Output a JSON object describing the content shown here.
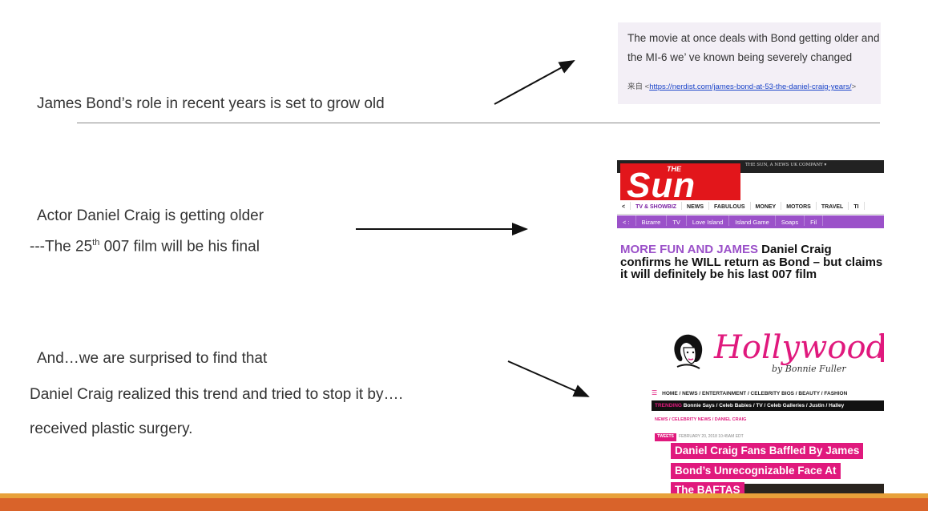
{
  "slide": {
    "line1": "James Bond’s role in recent years is set to grow old",
    "line2": "Actor Daniel Craig is getting older",
    "line3_prefix": "---The 25",
    "line3_sup": "th",
    "line3_suffix": " 007 film will be his final",
    "line4": "And…we are surprised to find that",
    "line5": "Daniel Craig realized this trend and tried to stop it by….",
    "line6": "received plastic surgery."
  },
  "quote": {
    "text": "The movie at once deals with Bond getting older and the MI-6 we’ ve known being severely changed",
    "source_prefix": "来自 <",
    "source_link": "https://nerdist.com/james-bond-at-53-the-daniel-craig-years/",
    "source_suffix": ">"
  },
  "sun": {
    "top_bar": "THE SUN, A NEWS UK COMPANY ▾",
    "logo_small": "THE",
    "logo_big": "Sun",
    "nav": [
      "<",
      "TV & SHOWBIZ",
      "NEWS",
      "FABULOUS",
      "MONEY",
      "MOTORS",
      "TRAVEL",
      "TI"
    ],
    "subnav": [
      "< :",
      "Bizarre",
      "TV",
      "Love Island",
      "Island Game",
      "Soaps",
      "Fil"
    ],
    "kicker": "MORE FUN AND JAMES",
    "headline": " Daniel Craig confirms he WILL return as Bond – but claims it will definitely be his last 007 film"
  },
  "hollywood": {
    "logo": "Hollywood Life",
    "byline": "by Bonnie Fuller",
    "nav1": "HOME / NEWS / ENTERTAINMENT / CELEBRITY BIOS / BEAUTY / FASHION",
    "nav2_label": "TRENDING",
    "nav2": "Bonnie Says / Celeb Babies / TV / Celeb Galleries / Justin / Halley",
    "crumbs": "NEWS / CELEBRITY NEWS / DANIEL CRAIG",
    "tweets": "TWEETS",
    "date": "FEBRUARY 20, 2018 10:45AM EDT",
    "headline_1": "Daniel Craig Fans Baffled By James",
    "headline_2": "Bond’s Unrecognizable Face At",
    "headline_3": "The BAFTAS"
  },
  "colors": {
    "sun_red": "#e2161b",
    "sun_purple": "#9b51c9",
    "hollywood_pink": "#e0197d",
    "accent_orange": "#d9632a",
    "accent_amber": "#e8a13a"
  }
}
